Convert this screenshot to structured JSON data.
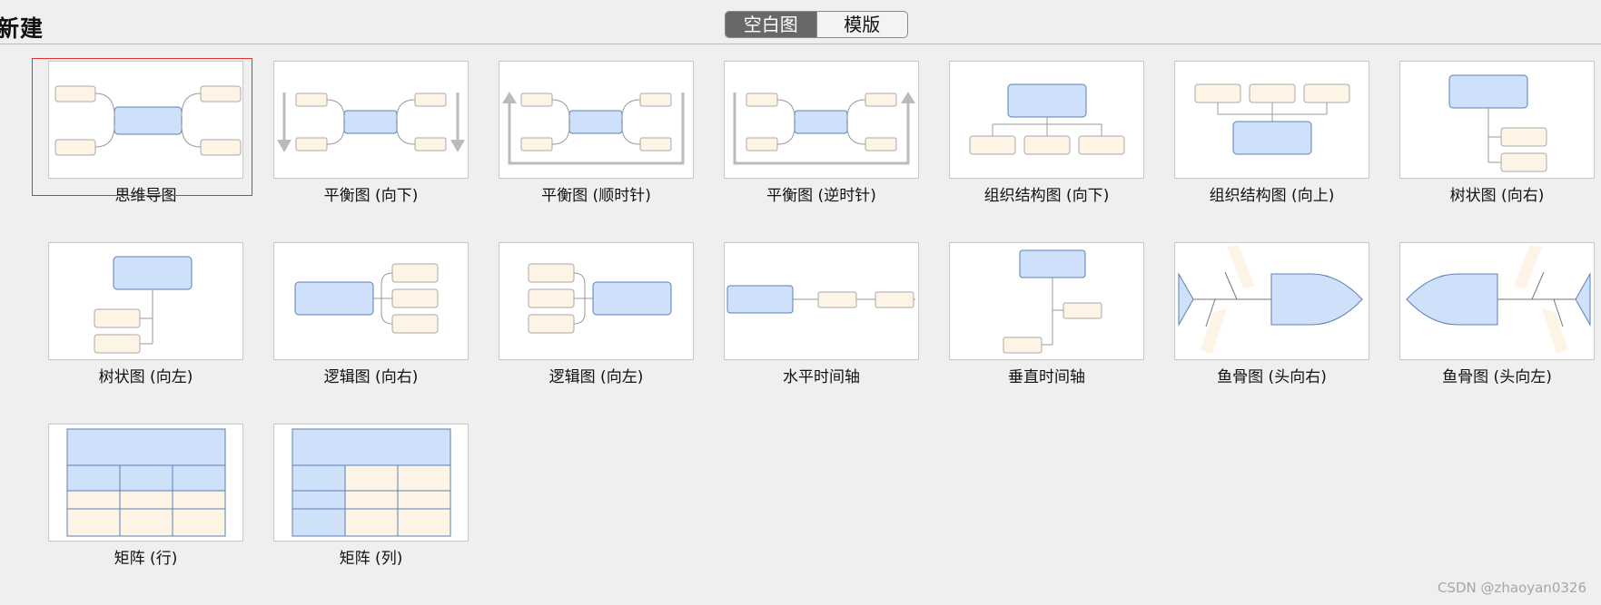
{
  "header": {
    "title": "新建",
    "tabs": [
      {
        "label": "空白图",
        "active": true
      },
      {
        "label": "模版",
        "active": false
      }
    ]
  },
  "templates": [
    {
      "id": "mindmap",
      "label": "思维导图",
      "selected": true
    },
    {
      "id": "balance-down",
      "label": "平衡图 (向下)"
    },
    {
      "id": "balance-clockwise",
      "label": "平衡图 (顺时针)"
    },
    {
      "id": "balance-counter",
      "label": "平衡图 (逆时针)"
    },
    {
      "id": "org-down",
      "label": "组织结构图 (向下)"
    },
    {
      "id": "org-up",
      "label": "组织结构图 (向上)"
    },
    {
      "id": "tree-right",
      "label": "树状图 (向右)"
    },
    {
      "id": "tree-left",
      "label": "树状图 (向左)"
    },
    {
      "id": "logic-right",
      "label": "逻辑图 (向右)"
    },
    {
      "id": "logic-left",
      "label": "逻辑图 (向左)"
    },
    {
      "id": "timeline-h",
      "label": "水平时间轴"
    },
    {
      "id": "timeline-v",
      "label": "垂直时间轴"
    },
    {
      "id": "fishbone-right",
      "label": "鱼骨图 (头向右)"
    },
    {
      "id": "fishbone-left",
      "label": "鱼骨图 (头向左)"
    },
    {
      "id": "matrix-row",
      "label": "矩阵 (行)"
    },
    {
      "id": "matrix-col",
      "label": "矩阵 (列)"
    }
  ],
  "watermark": "CSDN @zhaoyan0326",
  "colors": {
    "blue_fill": "#cfe0fb",
    "blue_stroke": "#5b7fb3",
    "beige_fill": "#fdf4e6",
    "beige_stroke": "#a9a9a9",
    "selection": "#e03232"
  }
}
